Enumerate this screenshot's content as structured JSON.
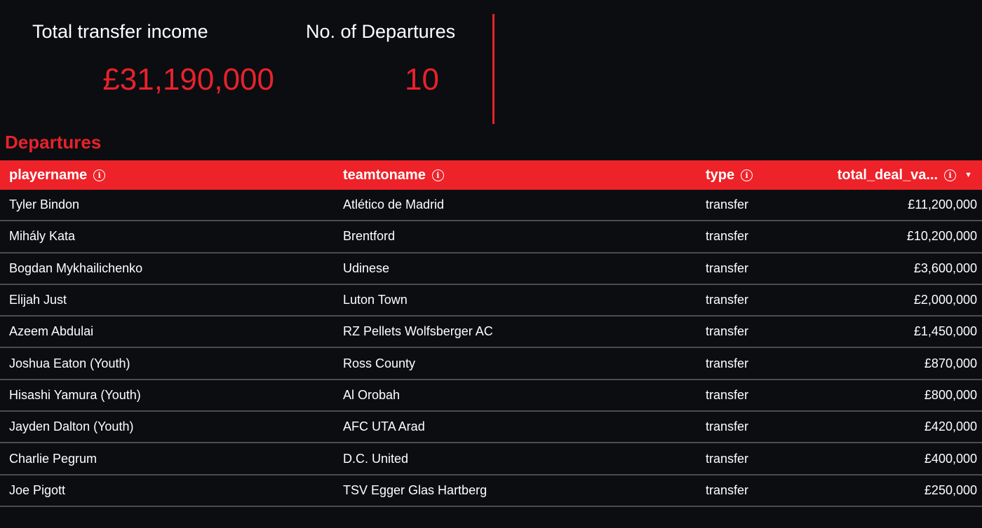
{
  "kpis": {
    "income": {
      "label": "Total transfer income",
      "value": "£31,190,000"
    },
    "departures": {
      "label": "No. of Departures",
      "value": "10"
    }
  },
  "section_title": "Departures",
  "table": {
    "columns": [
      {
        "label": "playername"
      },
      {
        "label": "teamtoname"
      },
      {
        "label": "type"
      },
      {
        "label": "total_deal_va..."
      }
    ],
    "sort_icon": "caret-down-icon",
    "rows": [
      {
        "player": "Tyler Bindon",
        "team": "Atlético de Madrid",
        "type": "transfer",
        "value": "£11,200,000"
      },
      {
        "player": "Mihály Kata",
        "team": "Brentford",
        "type": "transfer",
        "value": "£10,200,000"
      },
      {
        "player": "Bogdan Mykhailichenko",
        "team": "Udinese",
        "type": "transfer",
        "value": "£3,600,000"
      },
      {
        "player": "Elijah Just",
        "team": "Luton Town",
        "type": "transfer",
        "value": "£2,000,000"
      },
      {
        "player": "Azeem Abdulai",
        "team": "RZ Pellets Wolfsberger AC",
        "type": "transfer",
        "value": "£1,450,000"
      },
      {
        "player": "Joshua Eaton (Youth)",
        "team": "Ross County",
        "type": "transfer",
        "value": "£870,000"
      },
      {
        "player": "Hisashi Yamura (Youth)",
        "team": "Al Orobah",
        "type": "transfer",
        "value": "£800,000"
      },
      {
        "player": "Jayden Dalton (Youth)",
        "team": "AFC UTA Arad",
        "type": "transfer",
        "value": "£420,000"
      },
      {
        "player": "Charlie Pegrum",
        "team": "D.C. United",
        "type": "transfer",
        "value": "£400,000"
      },
      {
        "player": "Joe Pigott",
        "team": "TSV Egger Glas Hartberg",
        "type": "transfer",
        "value": "£250,000"
      }
    ]
  },
  "colors": {
    "accent": "#e8222b",
    "header_bg": "#ee2229",
    "background": "#0b0d11",
    "row_border": "#4a4c50"
  }
}
